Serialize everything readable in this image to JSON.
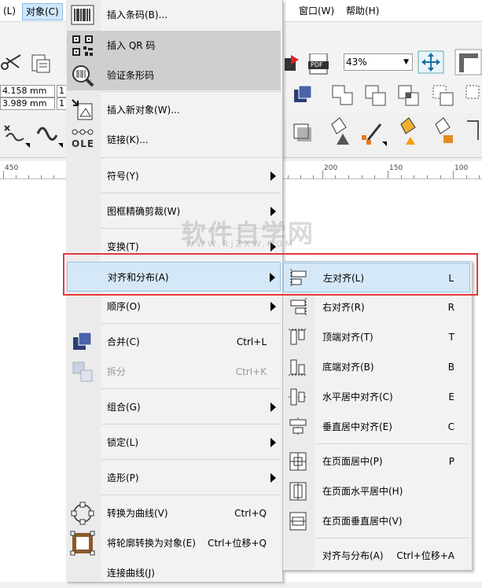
{
  "menubar": {
    "items": [
      {
        "label": "(L)"
      },
      {
        "label": "对象(C)"
      },
      {
        "label": "窗口(W)"
      },
      {
        "label": "帮助(H)"
      }
    ]
  },
  "toolbar": {
    "zoom_value": "43%",
    "width_value": "4.158 mm",
    "height_value": "3.989 mm",
    "small_box_1": "1",
    "small_box_2": "1",
    "pdf_label": "PDF"
  },
  "ruler": {
    "labels": [
      "450",
      "200",
      "150",
      "100"
    ]
  },
  "menu": {
    "items": [
      {
        "label": "插入条码(B)...",
        "shortcut": ""
      },
      {
        "label": "插入 QR 码",
        "shortcut": ""
      },
      {
        "label": "验证条形码",
        "shortcut": ""
      },
      {
        "label": "插入新对象(W)...",
        "shortcut": ""
      },
      {
        "label": "链接(K)...",
        "shortcut": ""
      },
      {
        "label": "符号(Y)",
        "shortcut": ""
      },
      {
        "label": "图框精确剪裁(W)",
        "shortcut": ""
      },
      {
        "label": "变换(T)",
        "shortcut": ""
      },
      {
        "label": "对齐和分布(A)",
        "shortcut": ""
      },
      {
        "label": "顺序(O)",
        "shortcut": ""
      },
      {
        "label": "合并(C)",
        "shortcut": "Ctrl+L"
      },
      {
        "label": "拆分",
        "shortcut": "Ctrl+K"
      },
      {
        "label": "组合(G)",
        "shortcut": ""
      },
      {
        "label": "锁定(L)",
        "shortcut": ""
      },
      {
        "label": "造形(P)",
        "shortcut": ""
      },
      {
        "label": "转换为曲线(V)",
        "shortcut": "Ctrl+Q"
      },
      {
        "label": "将轮廓转换为对象(E)",
        "shortcut": "Ctrl+位移+Q"
      },
      {
        "label": "连接曲线(J)",
        "shortcut": ""
      }
    ],
    "ole_label": "OLE"
  },
  "submenu": {
    "items": [
      {
        "label": "左对齐(L)",
        "shortcut": "L"
      },
      {
        "label": "右对齐(R)",
        "shortcut": "R"
      },
      {
        "label": "顶端对齐(T)",
        "shortcut": "T"
      },
      {
        "label": "底端对齐(B)",
        "shortcut": "B"
      },
      {
        "label": "水平居中对齐(C)",
        "shortcut": "E"
      },
      {
        "label": "垂直居中对齐(E)",
        "shortcut": "C"
      },
      {
        "label": "在页面居中(P)",
        "shortcut": "P"
      },
      {
        "label": "在页面水平居中(H)",
        "shortcut": ""
      },
      {
        "label": "在页面垂直居中(V)",
        "shortcut": ""
      },
      {
        "label": "对齐与分布(A)",
        "shortcut": "Ctrl+位移+A"
      }
    ]
  },
  "watermark": {
    "text": "软件自学网",
    "sub": "WWW.RJZXW.COM"
  },
  "colors": {
    "highlight": "#d5e8f8",
    "annotation": "#e53a3a",
    "accent": "#1e6fd0"
  }
}
